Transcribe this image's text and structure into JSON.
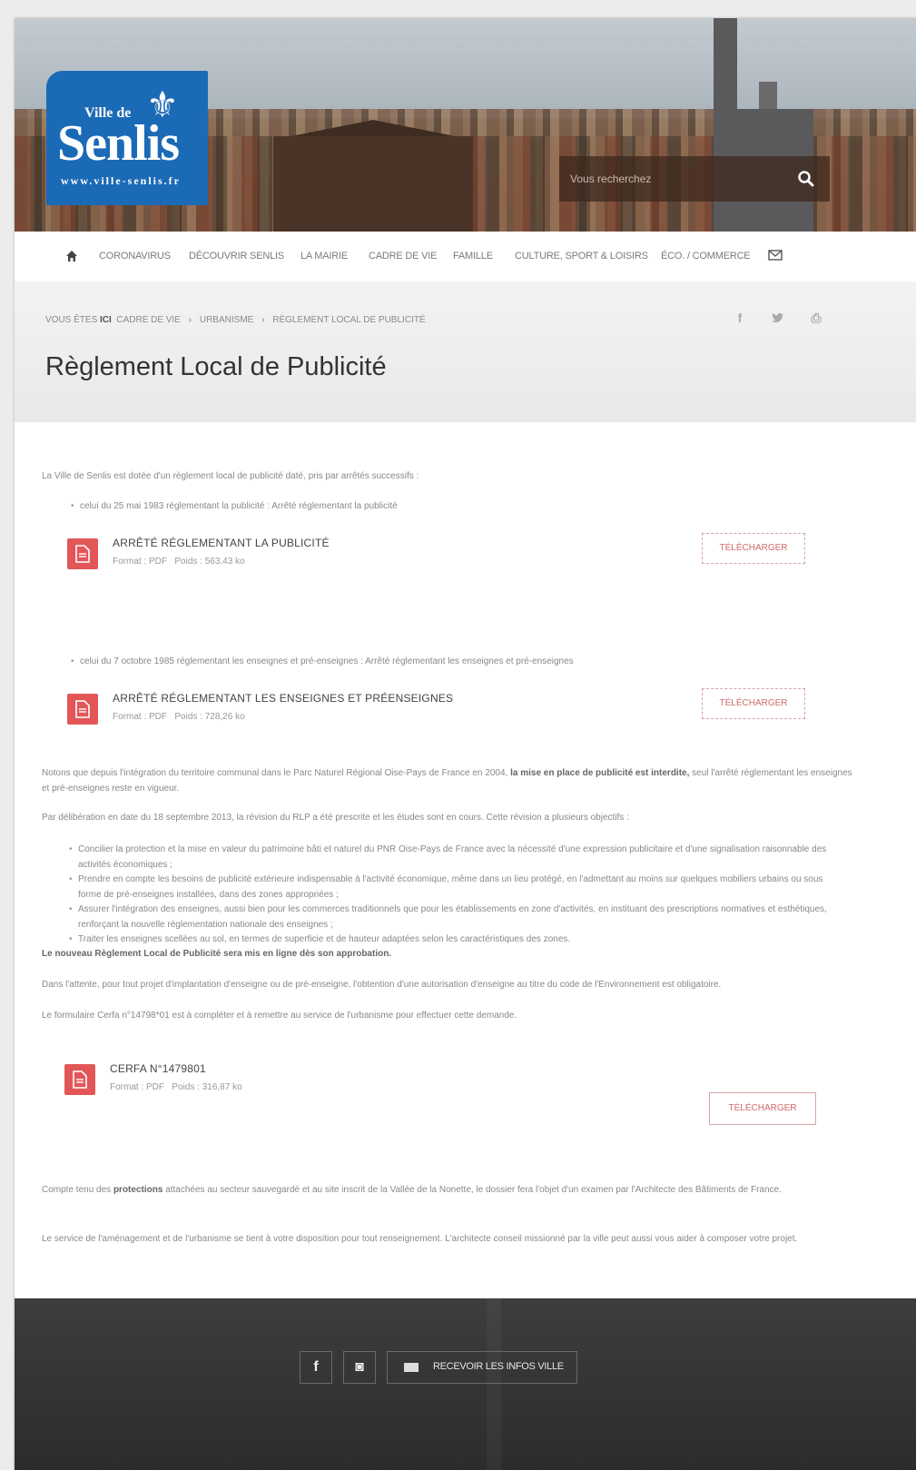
{
  "header": {
    "logo": {
      "ville": "Ville de",
      "name": "Senlis",
      "url": "www.ville-senlis.fr"
    },
    "search": {
      "placeholder": "Vous recherchez"
    }
  },
  "nav": {
    "items": [
      "CORONAVIRUS",
      "DÉCOUVRIR SENLIS",
      "LA MAIRIE",
      "CADRE DE VIE",
      "FAMILLE",
      "CULTURE, SPORT & LOISIRS",
      "ÉCO. / COMMERCE"
    ]
  },
  "breadcrumb": {
    "prefix": "VOUS ÊTES",
    "here": "ICI",
    "items": [
      "CADRE DE VIE",
      "URBANISME",
      "RÈGLEMENT LOCAL DE PUBLICITÉ"
    ]
  },
  "share": {
    "facebook": "f",
    "twitter": "t",
    "print": "⎙"
  },
  "page_title": "Règlement Local de Publicité",
  "content": {
    "intro": "La Ville de Senlis est dotée d'un règlement local de publicité daté, pris par arrêtés successifs :",
    "bullet1": "celui du 25 mai 1983 réglementant la publicité : Arrêté réglementant la publicité",
    "bullet2": "celui du 7 octobre 1985 réglementant les enseignes et pré-enseignes : Arrêté réglementant les enseignes et pré-enseignes",
    "para1a": "Notons que depuis l'intégration du territoire communal dans le Parc Naturel Régional Oise-Pays de France en 2004,",
    "para1b": "la mise en place de publicité est interdite,",
    "para1c": "seul l'arrêté réglementant les enseignes et pré-enseignes reste en vigueur.",
    "para2": "Par délibération en date du 18 septembre 2013, la révision du RLP a été prescrite et les études sont en cours. Cette révision a plusieurs objectifs :",
    "objectives": [
      "Concilier la protection et la mise en valeur du patrimoine bâti et naturel du PNR Oise-Pays de France avec la nécessité d'une expression publicitaire et d'une signalisation raisonnable des activités économiques ;",
      "Prendre en compte les besoins de publicité extérieure indispensable à l'activité économique, même dans un lieu protégé, en l'admettant au moins sur quelques mobiliers urbains ou sous forme de pré-enseignes installées, dans des zones appropriées ;",
      "Assurer l'intégration des enseignes, aussi bien pour les commerces traditionnels que pour les établissements en zone d'activités, en instituant des prescriptions normatives et esthétiques, renforçant la nouvelle réglementation nationale des enseignes ;",
      "Traiter les enseignes scellées au sol, en termes de superficie et de hauteur adaptées selon les caractéristiques des zones."
    ],
    "para3": "Le nouveau Règlement Local de Publicité sera mis en ligne dès son approbation.",
    "para4": "Dans l'attente, pour tout projet d'implantation d'enseigne ou de pré-enseigne, l'obtention d'une autorisation d'enseigne au titre du code de l'Environnement est obligatoire.",
    "para5": "Le formulaire Cerfa n°14798*01 est à compléter et à remettre au service de l'urbanisme pour effectuer cette demande.",
    "para6a": "Compte tenu des",
    "para6b": "protections",
    "para6c": "attachées au secteur sauvegardé et au site inscrit de la Vallée de la Nonette, le dossier fera l'objet d'un examen par l'Architecte des Bâtiments de France.",
    "para7": "Le service de l'aménagement et de l'urbanisme se tient à votre disposition pour tout renseignement. L'architecte conseil missionné par la ville peut aussi vous aider à composer votre projet."
  },
  "documents": [
    {
      "title": "ARRÊTÉ RÉGLEMENTANT LA PUBLICITÉ",
      "format_label": "Format : PDF",
      "size_label": "Poids : 563,43 ko",
      "button": "TÉLÉCHARGER"
    },
    {
      "title": "ARRÊTÉ RÉGLEMENTANT LES ENSEIGNES ET PRÉENSEIGNES",
      "format_label": "Format : PDF",
      "size_label": "Poids : 728,26 ko",
      "button": "TÉLÉCHARGER"
    },
    {
      "title": "CERFA N°1479801",
      "format_label": "Format : PDF",
      "size_label": "Poids : 316,87 ko",
      "button": "TÉLÉCHARGER"
    }
  ],
  "footer": {
    "facebook": "f",
    "instagram": "◙",
    "newsletter_label": "RECEVOIR LES INFOS VILLE"
  },
  "colors": {
    "brand_blue": "#1b6ab6",
    "accent_red": "#e25658",
    "footer": "#333333"
  }
}
